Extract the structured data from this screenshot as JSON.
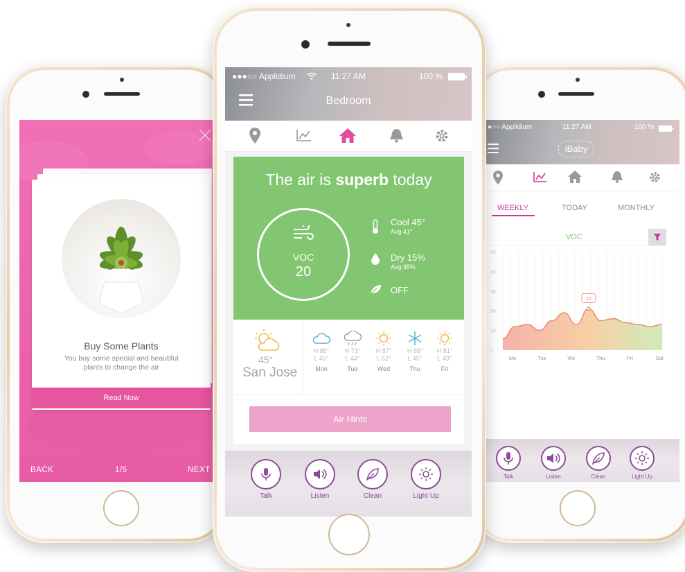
{
  "left": {
    "card_title": "Buy Some Plants",
    "card_body_1": "You buy some special and beautiful",
    "card_body_2": "plants to change the air",
    "read_now": "Read Now",
    "nav_back": "BACK",
    "nav_page": "1/5",
    "nav_next": "NEXT"
  },
  "center": {
    "status_carrier": "●●●○○ Applidium",
    "status_time": "11:27 AM",
    "status_battery": "100 %",
    "title": "Bedroom",
    "tabs": [
      "location-icon",
      "chart-icon",
      "home-icon",
      "bell-icon",
      "gear-icon"
    ],
    "air_pre": "The air is ",
    "air_bold": "superb",
    "air_post": " today",
    "voc_label": "VOC",
    "voc_value": "20",
    "temp_main": "Cool 45°",
    "temp_sub": "Avg 41°",
    "humid_main": "Dry 15%",
    "humid_sub": "Avg 35%",
    "purifier": "OFF",
    "current_temp": "45°",
    "city": "San Jose",
    "forecast": [
      {
        "high": "H 85°",
        "low": "L 45°",
        "day": "Mon",
        "icon": "cloud-icon"
      },
      {
        "high": "H 73°",
        "low": "L 44°",
        "day": "Tue",
        "icon": "rain-icon"
      },
      {
        "high": "H 87°",
        "low": "L 52°",
        "day": "Wed",
        "icon": "sun-icon"
      },
      {
        "high": "H 85°",
        "low": "L 45°",
        "day": "Thu",
        "icon": "snow-icon"
      },
      {
        "high": "H 81°",
        "low": "L 43°",
        "day": "Fri",
        "icon": "sun-icon"
      }
    ],
    "air_hints": "Air Hints",
    "actions": [
      "Talk",
      "Listen",
      "Clean",
      "Light Up"
    ]
  },
  "right": {
    "status_carrier": "●○○ Applidium",
    "status_time": "11:27 AM",
    "status_battery": "100 %",
    "logo": "iBaby",
    "segments": [
      "WEEKLY",
      "TODAY",
      "MONTHLY"
    ],
    "chart_title": "VOC",
    "actions": [
      "Talk",
      "Listen",
      "Clean",
      "Light Up"
    ]
  },
  "chart_data": {
    "type": "area",
    "title": "VOC",
    "categories": [
      "Mo",
      "Tue",
      "We",
      "Thu",
      "Fri",
      "Sat"
    ],
    "y_ticks": [
      0,
      10,
      20,
      30,
      40,
      50
    ],
    "ylim": [
      0,
      50
    ],
    "values": [
      6,
      12,
      13,
      10,
      15,
      19,
      13,
      21,
      15,
      16,
      14,
      13,
      12,
      13
    ],
    "highlight_label": "10",
    "grid": true,
    "colors": [
      "#f19a8b",
      "#f5c089",
      "#bfe6a1"
    ]
  },
  "colors": {
    "pink": "#ec67ad",
    "green": "#82c671",
    "purple": "#8b4c97",
    "magenta": "#c63a93"
  }
}
